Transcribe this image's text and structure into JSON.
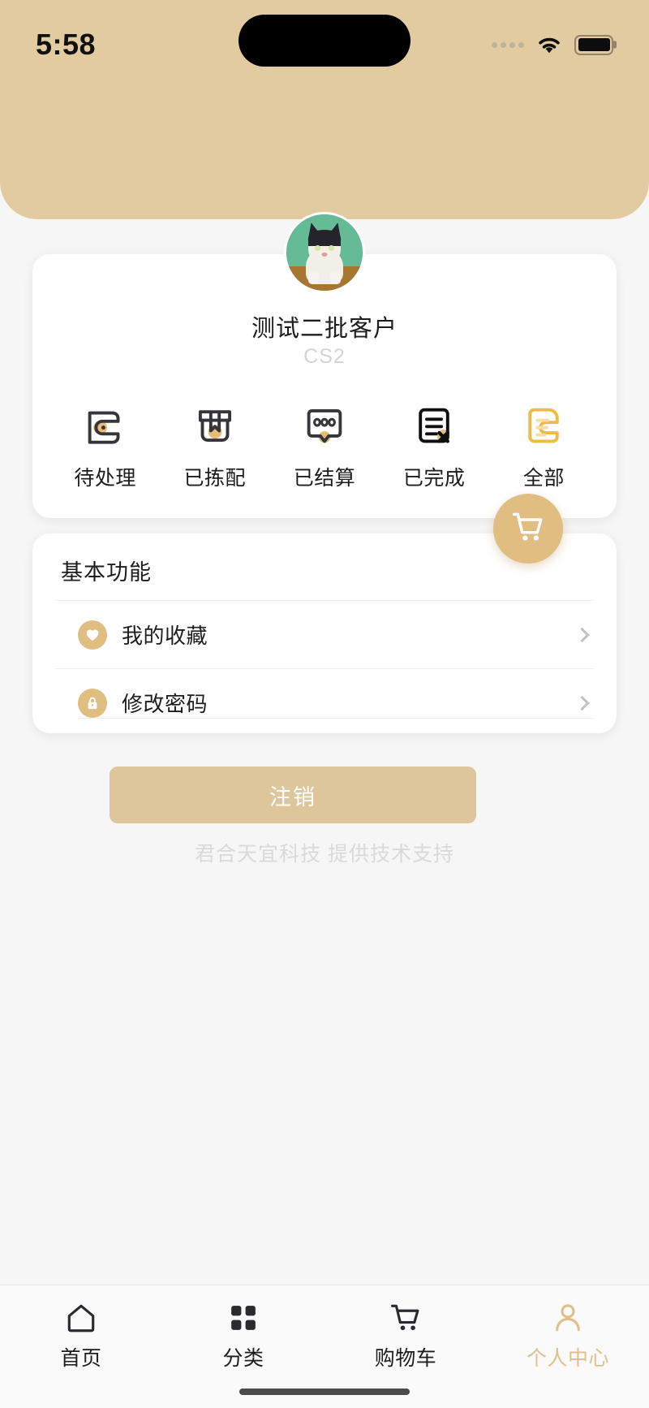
{
  "status_bar": {
    "time": "5:58",
    "signal_icon": "signal-dots-icon",
    "wifi_icon": "wifi-icon",
    "battery_icon": "battery-icon"
  },
  "theme": {
    "header_bg": "#e2cba1",
    "accent": "#e0bd80",
    "page_bg": "#f6f6f6",
    "card_bg": "#ffffff",
    "muted_text": "#d4d4d6",
    "primary_text": "#1d1d1f"
  },
  "profile": {
    "avatar_alt": "cat-avatar",
    "name": "测试二批客户",
    "code": "CS2"
  },
  "order_status": {
    "items": [
      {
        "label": "待处理",
        "icon": "wallet-icon"
      },
      {
        "label": "已拣配",
        "icon": "package-box-icon"
      },
      {
        "label": "已结算",
        "icon": "chat-dots-icon"
      },
      {
        "label": "已完成",
        "icon": "document-x-icon"
      },
      {
        "label": "全部",
        "icon": "document-list-icon"
      }
    ]
  },
  "floating_action": {
    "icon": "shopping-cart-icon",
    "label": "购物车"
  },
  "functions": {
    "title": "基本功能",
    "items": [
      {
        "label": "我的收藏",
        "icon": "heart-icon",
        "chevron": "chevron-right-icon"
      },
      {
        "label": "修改密码",
        "icon": "lock-icon",
        "chevron": "chevron-right-icon"
      }
    ]
  },
  "logout": {
    "label": "注销"
  },
  "footer": {
    "text": "君合天宜科技 提供技术支持"
  },
  "tabbar": {
    "items": [
      {
        "label": "首页",
        "icon": "home-icon",
        "active": false
      },
      {
        "label": "分类",
        "icon": "grid-icon",
        "active": false
      },
      {
        "label": "购物车",
        "icon": "cart-icon",
        "active": false
      },
      {
        "label": "个人中心",
        "icon": "user-icon",
        "active": true
      }
    ]
  }
}
